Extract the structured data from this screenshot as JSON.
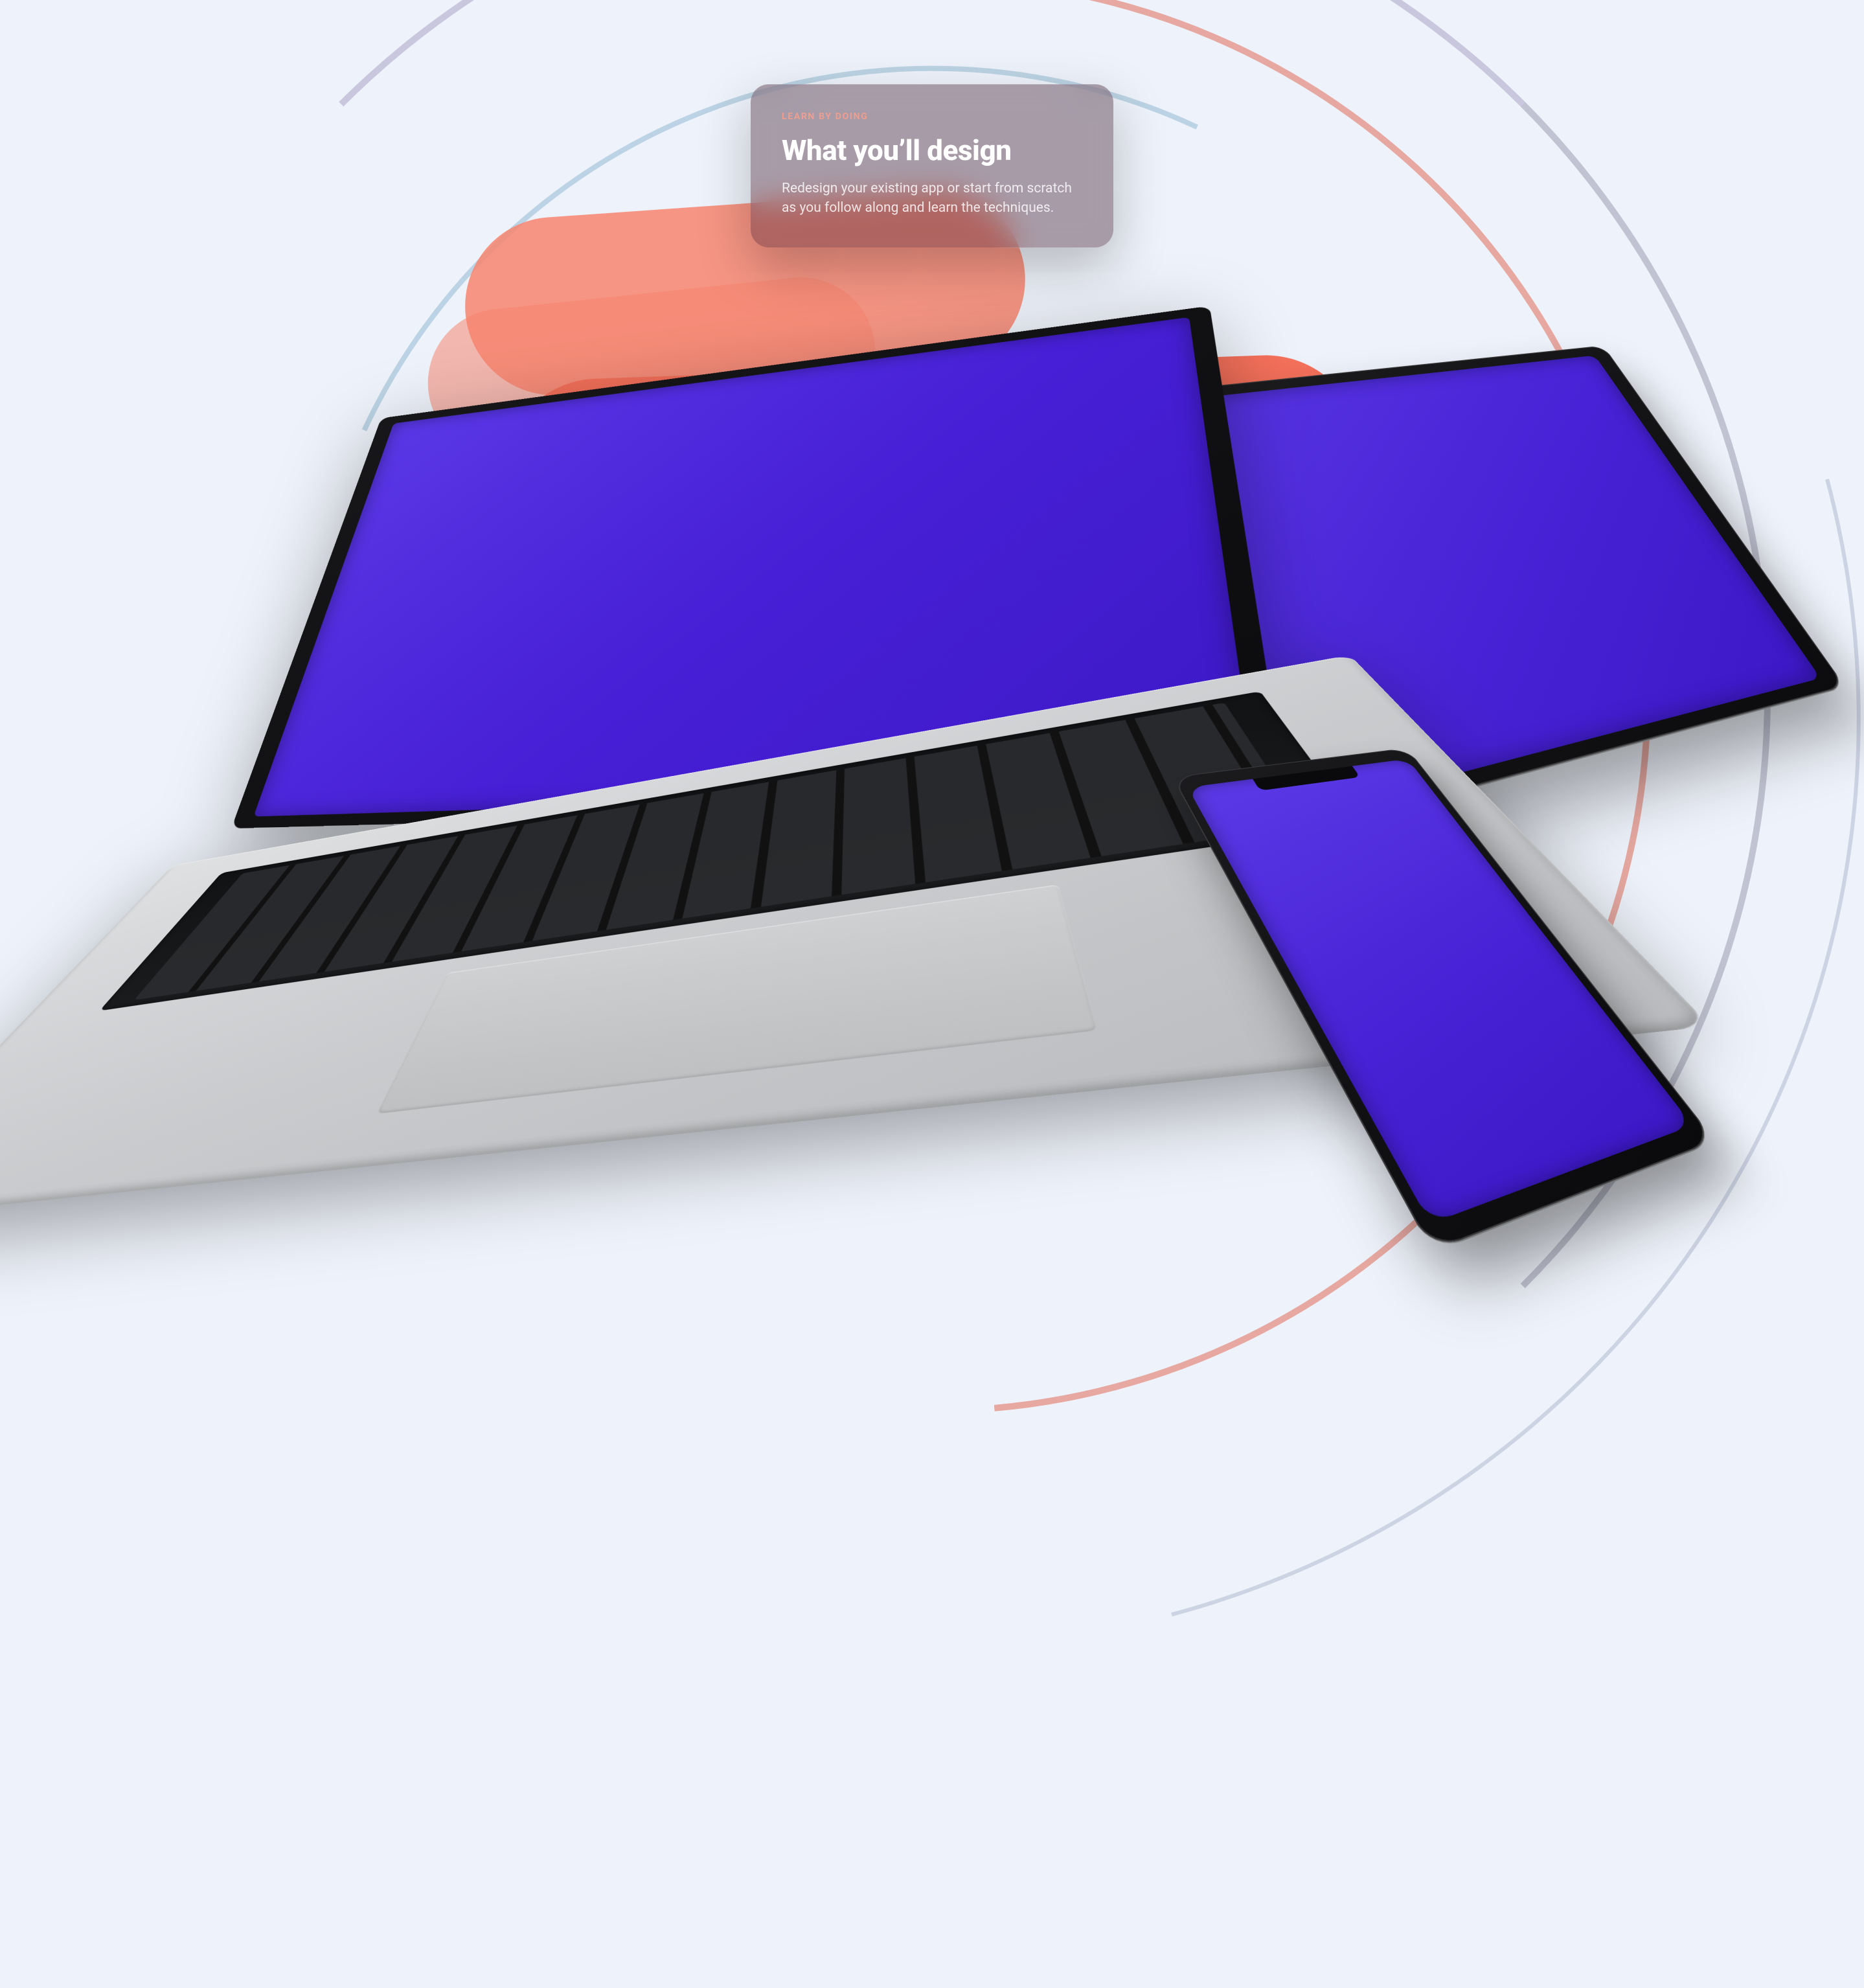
{
  "hero": {
    "eyebrow": "LEARN BY DOING",
    "title": "What you’ll design",
    "body": "Redesign your existing app or start from scratch as you follow along and learn the techniques."
  },
  "devices": {
    "laptop_label": "laptop-mockup",
    "tablet_label": "tablet-mockup",
    "phone_label": "phone-mockup"
  },
  "colors": {
    "accent_screen": "#4722d6",
    "blob_primary": "#ef5c46",
    "blob_secondary": "#5d3fcf",
    "eyebrow": "#f19e8f",
    "page_bg": "#eef2fa"
  }
}
